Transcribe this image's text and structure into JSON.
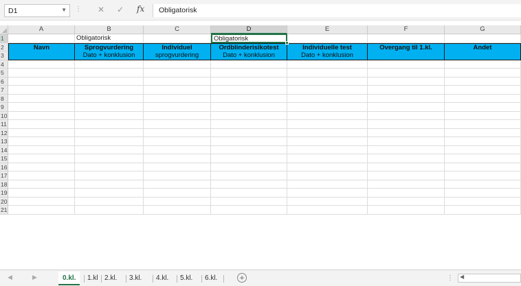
{
  "formula_bar": {
    "name_box": "D1",
    "fx": "fx",
    "content": "Obligatorisk"
  },
  "columns": [
    "A",
    "B",
    "C",
    "D",
    "E",
    "F",
    "G"
  ],
  "rows": [
    "1",
    "2",
    "3",
    "4",
    "5",
    "6",
    "7",
    "8",
    "9",
    "10",
    "11",
    "12",
    "13",
    "14",
    "15",
    "16",
    "17",
    "18",
    "19",
    "20",
    "21"
  ],
  "cells": {
    "B1": "Obligatorisk",
    "D1": "Obligatorisk",
    "A2": "Navn",
    "B2": "Sprogvurdering",
    "C2": "Individuel",
    "D2": "Ordblinderisikotest",
    "E2": "Individuelle test",
    "F2": "Overgang til 1.kl.",
    "G2": "Andet",
    "B3": "Dato + konklusion",
    "C3": "sprogvurdering",
    "D3": "Dato + konklusion",
    "E3": "Dato + konklusion"
  },
  "sheet_tabs": [
    "0.kl.",
    "1.kl",
    "2.kl.",
    "3.kl.",
    "4.kl.",
    "5.kl.",
    "6.kl."
  ],
  "active_tab": "0.kl.",
  "colors": {
    "header_fill": "#00b0f0",
    "excel_green": "#217346"
  }
}
